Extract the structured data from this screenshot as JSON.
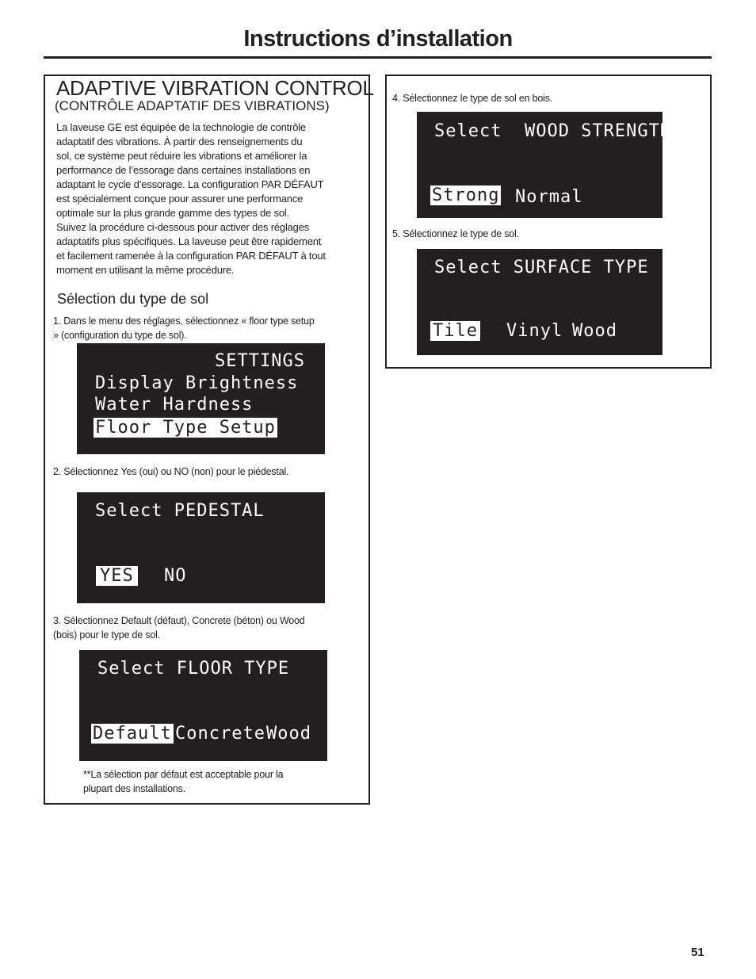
{
  "page": {
    "title": "Instructions d’installation",
    "page_number": "51"
  },
  "left_panel": {
    "heading": "ADAPTIVE VIBRATION CONTROL",
    "subheading": "(CONTRÔLE ADAPTATIF DES VIBRATIONS)",
    "intro_lines": [
      "La laveuse GE est équipée de la technologie de contrôle",
      "adaptatif des vibrations. À partir des renseignements du",
      "sol, ce système peut réduire les vibrations et améliorer la",
      "performance de l’essorage dans certaines installations en",
      "adaptant le cycle d’essorage. La configuration PAR DÉFAUT",
      "est spécialement conçue pour assurer une performance",
      "optimale sur la plus grande gamme des types de sol.",
      "Suivez la procédure ci-dessous pour activer des réglages",
      "adaptatifs plus spécifiques. La laveuse peut être rapidement",
      "et facilement ramenée à la configuration PAR DÉFAUT à tout",
      "moment en utilisant la même procédure."
    ],
    "section_heading": "Sélection du type de sol",
    "step1": {
      "text_lines": [
        "1. Dans le menu des réglages, sélectionnez « floor type setup",
        "» (configuration du type de sol)."
      ],
      "display": {
        "title": "SETTINGS",
        "items": [
          "Display Brightness",
          "Water Hardness",
          "Floor Type Setup"
        ],
        "selected": "Floor Type Setup"
      }
    },
    "step2": {
      "text": "2. Sélectionnez Yes (oui) ou NO (non) pour le piédestal.",
      "display": {
        "title": "Select PEDESTAL",
        "options": [
          "YES",
          "NO"
        ],
        "selected": "YES"
      }
    },
    "step3": {
      "text_lines": [
        "3. Sélectionnez Default (défaut), Concrete (béton) ou Wood",
        "(bois) pour le type de sol."
      ],
      "display": {
        "title": "Select FLOOR TYPE",
        "options": [
          "Default",
          "Concrete",
          "Wood"
        ],
        "selected": "Default"
      },
      "note_lines": [
        "**La sélection par défaut est acceptable pour la",
        "plupart des installations."
      ]
    }
  },
  "right_panel": {
    "step4": {
      "text": "4. Sélectionnez le type de sol en bois.",
      "display": {
        "title": "Select  WOOD STRENGTH",
        "options": [
          "Strong",
          "Normal"
        ],
        "selected": "Strong"
      }
    },
    "step5": {
      "text": "5. Sélectionnez le type de sol.",
      "display": {
        "title": "Select SURFACE TYPE",
        "options": [
          "Tile",
          "Vinyl",
          "Wood"
        ],
        "selected": "Tile"
      }
    }
  },
  "colors": {
    "ink": "#231f20",
    "paper": "#ffffff",
    "lcd_background": "#231f20",
    "lcd_text": "#ffffff"
  }
}
